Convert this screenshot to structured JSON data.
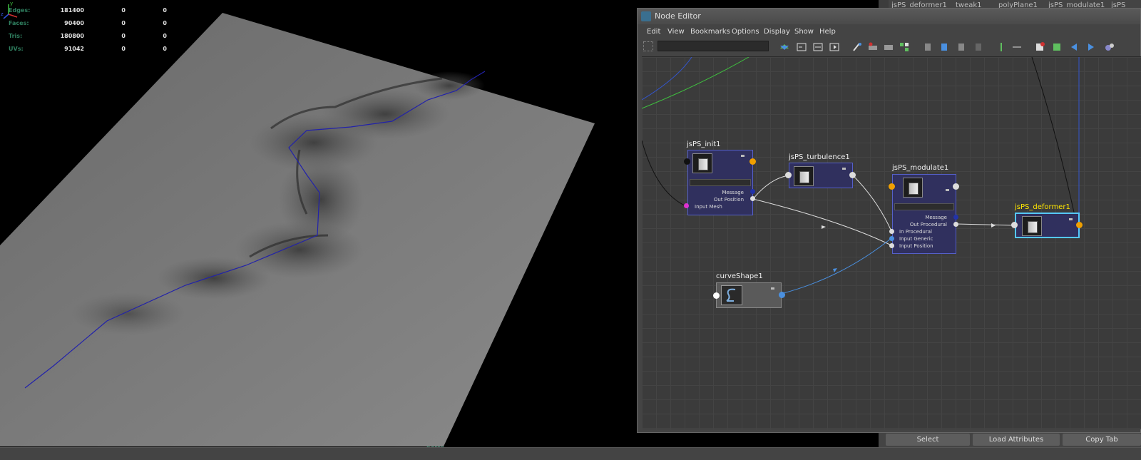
{
  "viewport": {
    "stats": [
      {
        "label": "Edges:",
        "v1": "181400",
        "v2": "0",
        "v3": "0"
      },
      {
        "label": "Faces:",
        "v1": "90400",
        "v2": "0",
        "v3": "0"
      },
      {
        "label": "Tris:",
        "v1": "180800",
        "v2": "0",
        "v3": "0"
      },
      {
        "label": "UVs:",
        "v1": "91042",
        "v2": "0",
        "v3": "0"
      }
    ],
    "camera": "persp",
    "axis_y": "y",
    "axis_z": "z"
  },
  "attribute_editor": {
    "tabs": [
      "jsPS_deformer1",
      "tweak1",
      "polyPlane1",
      "jsPS_modulate1",
      "jsPS"
    ],
    "select_label": "Select",
    "load_label": "Load Attributes",
    "copy_label": "Copy Tab"
  },
  "node_editor": {
    "title": "Node Editor",
    "menu": [
      "Edit",
      "View",
      "Bookmarks",
      "Options",
      "Display",
      "Show",
      "Help"
    ],
    "search_value": "",
    "nodes": {
      "init": {
        "name": "jsPS_init1",
        "ports": {
          "message": "Message",
          "out_position": "Out Position",
          "input_mesh": "Input Mesh"
        }
      },
      "turbulence": {
        "name": "jsPS_turbulence1"
      },
      "modulate": {
        "name": "jsPS_modulate1",
        "ports": {
          "message": "Message",
          "out_procedural": "Out Procedural",
          "in_procedural": "In Procedural",
          "input_generic": "Input Generic",
          "input_position": "Input Position"
        }
      },
      "deformer": {
        "name": "jsPS_deformer1"
      },
      "curve": {
        "name": "curveShape1"
      }
    },
    "colors": {
      "selected_title": "#ffe600",
      "node_bg": "#30305e",
      "wire_default": "#dddddd",
      "wire_blue": "#4a90e0",
      "wire_green": "#3fbf3f"
    }
  }
}
